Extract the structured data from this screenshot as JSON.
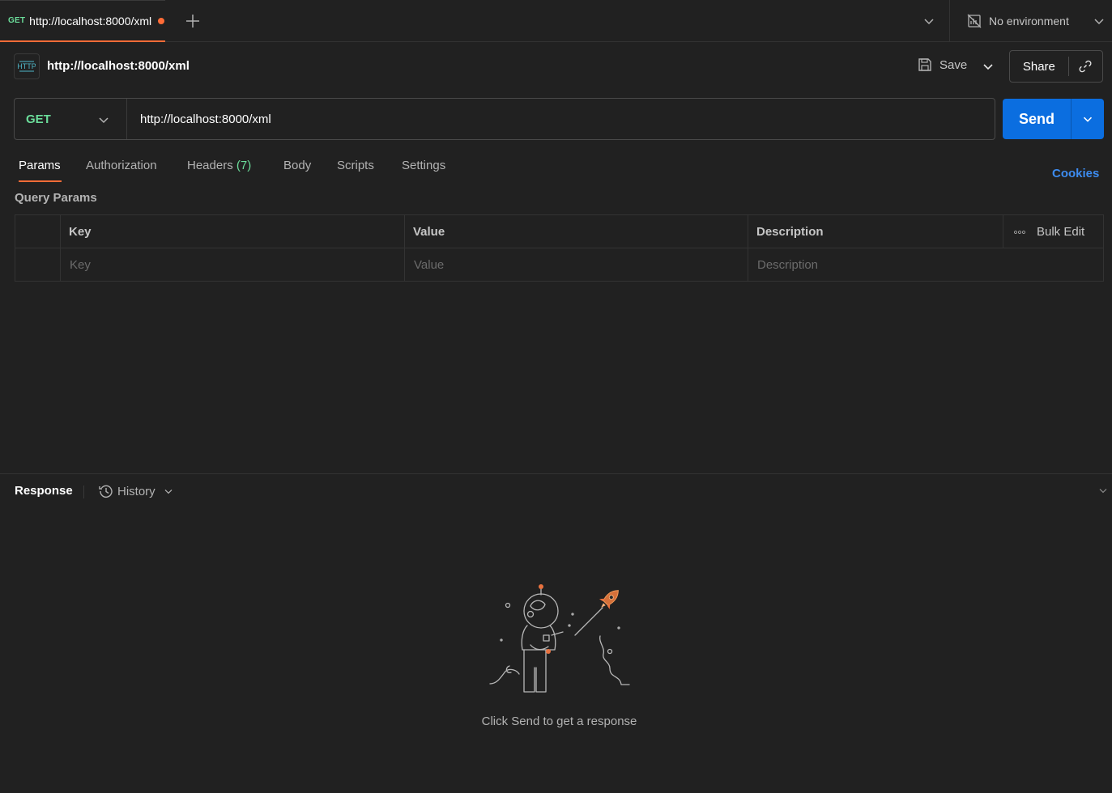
{
  "tabbar": {
    "tab": {
      "method": "GET",
      "url": "http://localhost:8000/xml"
    },
    "new_tab_icon": "plus-icon",
    "environment": "No environment"
  },
  "request": {
    "icon": "http-icon",
    "title": "http://localhost:8000/xml",
    "save_label": "Save",
    "share_label": "Share",
    "method": "GET",
    "url": "http://localhost:8000/xml",
    "send_label": "Send"
  },
  "request_tabs": [
    {
      "label": "Params",
      "active": true
    },
    {
      "label": "Authorization"
    },
    {
      "label": "Headers",
      "count": "(7)"
    },
    {
      "label": "Body"
    },
    {
      "label": "Scripts"
    },
    {
      "label": "Settings"
    }
  ],
  "cookies_label": "Cookies",
  "query_params": {
    "title": "Query Params",
    "headers": {
      "key": "Key",
      "value": "Value",
      "description": "Description"
    },
    "bulk_edit_label": "Bulk Edit",
    "placeholders": {
      "key": "Key",
      "value": "Value",
      "description": "Description"
    }
  },
  "response": {
    "title": "Response",
    "history_label": "History",
    "empty_message": "Click Send to get a response"
  },
  "colors": {
    "accent_orange": "#ff6c37",
    "method_green": "#6bdd9a",
    "send_blue": "#0b6ee0",
    "link_blue": "#3d8cf0",
    "background": "#212121"
  }
}
